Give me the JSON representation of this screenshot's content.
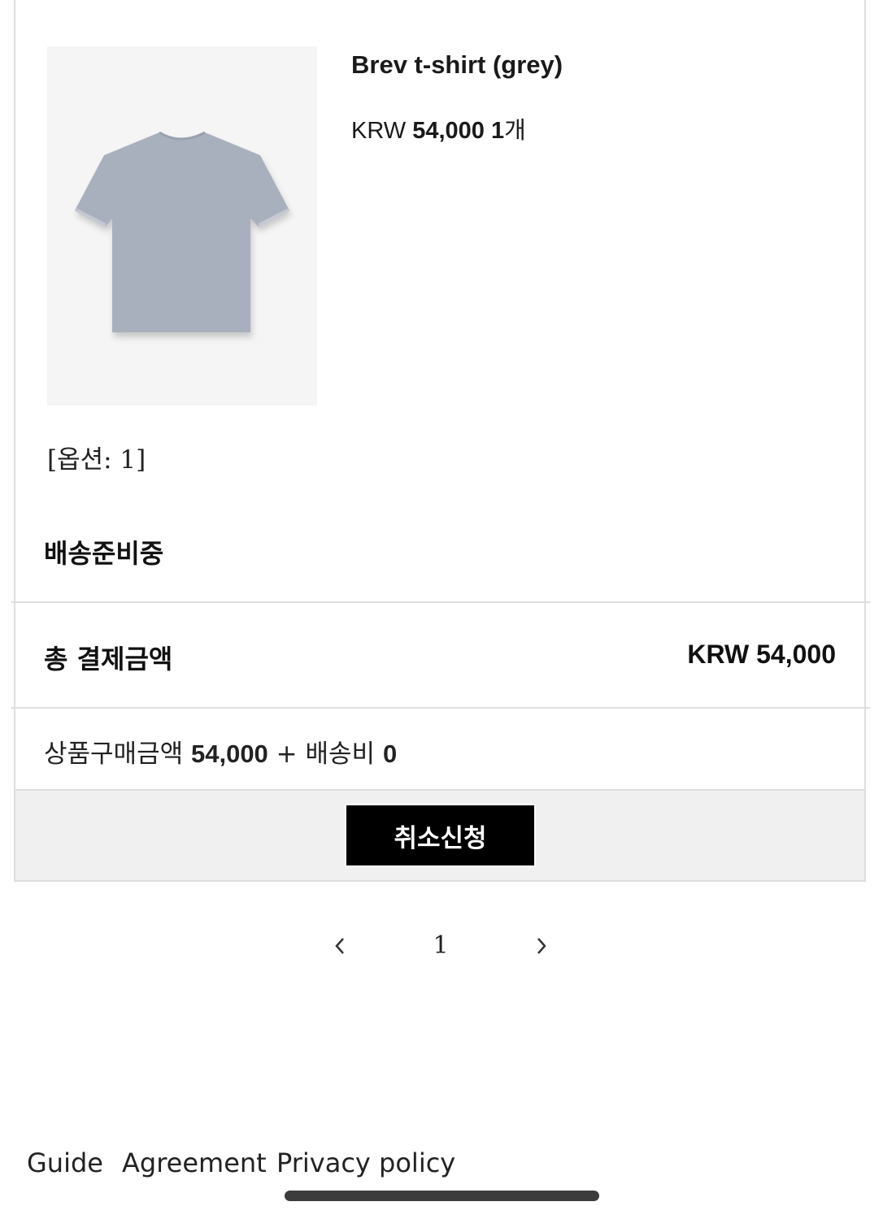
{
  "product": {
    "name": "Brev t-shirt (grey)",
    "currency": "KRW",
    "price": "54,000",
    "quantity": "1",
    "quantity_unit": "개",
    "option": "[옵션: 1]",
    "image_icon": "grey-tshirt-image",
    "status": "배송준비중"
  },
  "totals": {
    "label": "총 결제금액",
    "value": "KRW 54,000",
    "breakdown": {
      "goods_label": "상품구매금액",
      "goods_amount": "54,000",
      "plus": "+",
      "shipping_label": "배송비",
      "shipping_amount": "0"
    }
  },
  "actions": {
    "cancel_label": "취소신청"
  },
  "pagination": {
    "prev_icon": "chevron-left-icon",
    "current_page": "1",
    "next_icon": "chevron-right-icon"
  },
  "footer": {
    "links": [
      "Guide",
      "Agreement",
      "Privacy policy"
    ]
  },
  "colors": {
    "button_bg": "#000000",
    "button_text": "#ffffff",
    "action_area_bg": "#f0f0f0",
    "divider": "#dedede",
    "product_image_bg": "#f5f5f5",
    "tshirt": "#a9b0bd"
  }
}
